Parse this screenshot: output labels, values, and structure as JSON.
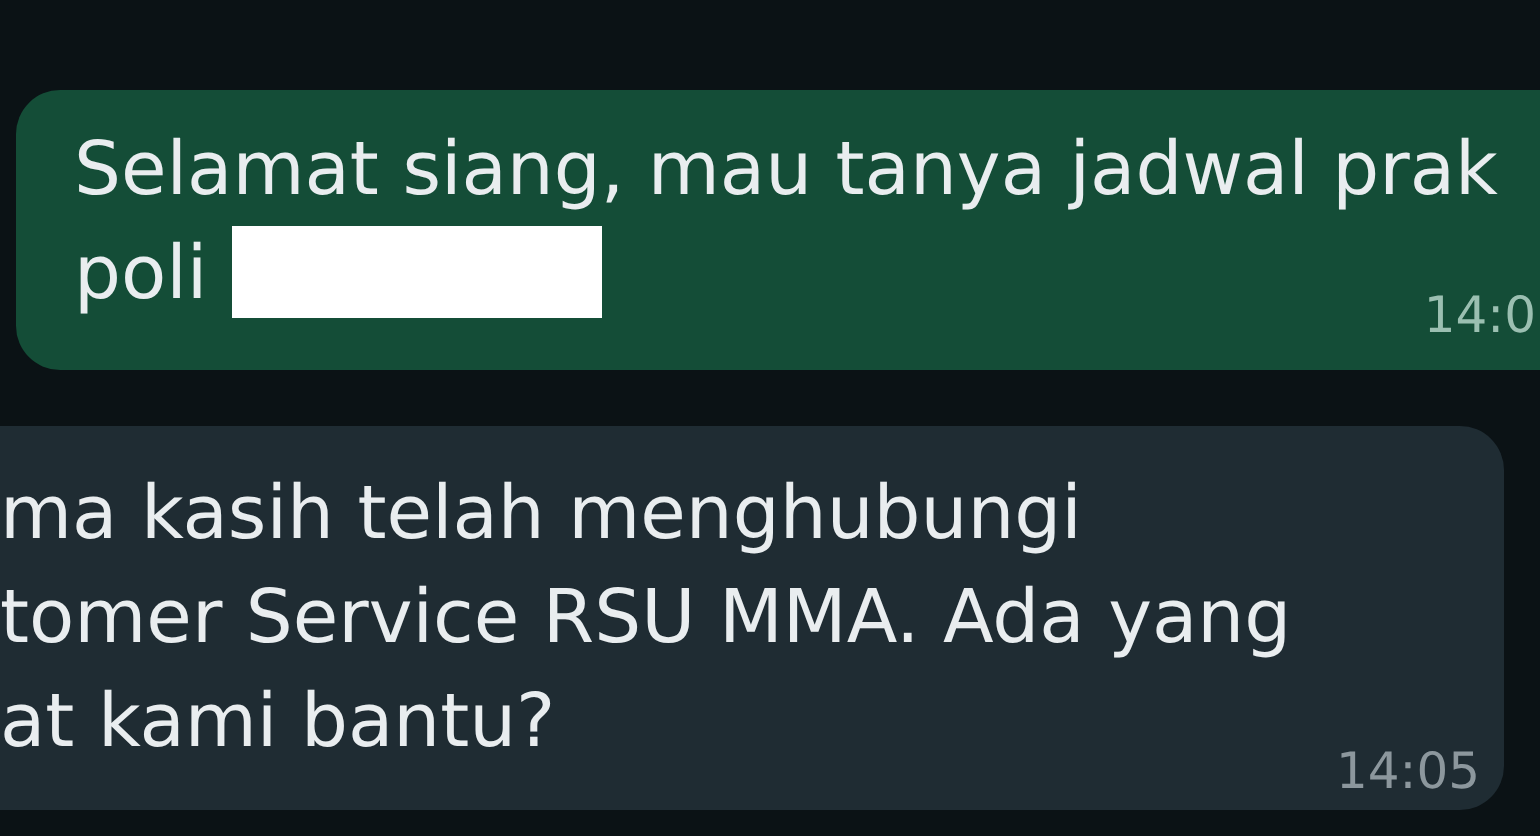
{
  "messages": [
    {
      "kind": "sent",
      "lines": [
        "Selamat siang, mau tanya jadwal prak",
        "poli"
      ],
      "redacted": true,
      "time": "14:0"
    },
    {
      "kind": "received",
      "lines": [
        "ma kasih telah menghubungi",
        "tomer Service RSU MMA. Ada yang",
        "at kami bantu?"
      ],
      "redacted": false,
      "time": "14:05"
    }
  ]
}
